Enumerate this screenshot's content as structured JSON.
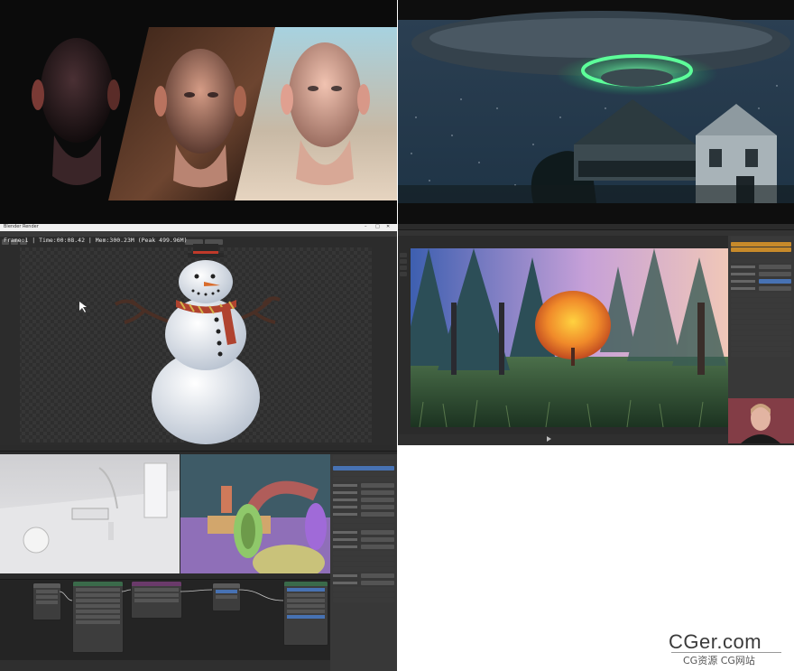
{
  "heads_panel": {
    "description_free": true
  },
  "snowman_editor": {
    "title_bar": "Blender Render",
    "window_controls": [
      "–",
      "□",
      "✕"
    ],
    "frame_info": "Frame:1 | Time:00:08.42 | Mem:300.23M (Peak 499.96M)"
  },
  "watermark": {
    "logo": "CGer.com",
    "subtitle": "CG资源 CG网站"
  },
  "colors": {
    "blender_dark": "#2b2b2b",
    "blender_panel": "#383838",
    "blender_accent": "#4772b3",
    "watermark_text": "#333333"
  },
  "icons": [
    "close-icon",
    "minimize-icon",
    "maximize-icon",
    "play-icon",
    "cursor-icon"
  ]
}
